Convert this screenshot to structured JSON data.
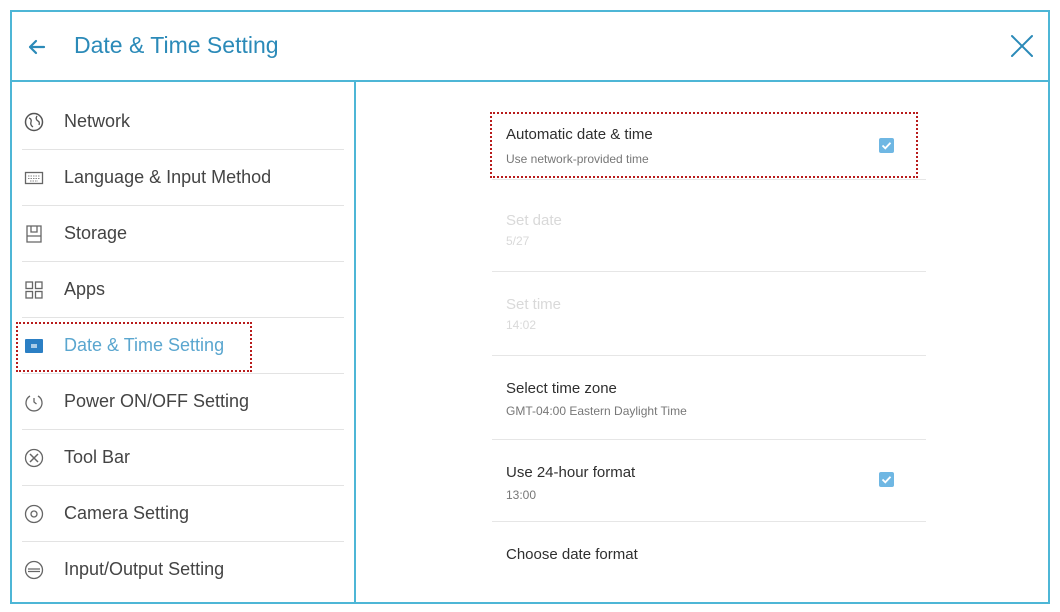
{
  "header": {
    "title": "Date & Time Setting",
    "back_icon": "arrow-left-icon",
    "close_icon": "close-icon"
  },
  "sidebar": {
    "items": [
      {
        "label": "Network",
        "icon": "globe-icon"
      },
      {
        "label": "Language & Input Method",
        "icon": "keyboard-icon"
      },
      {
        "label": "Storage",
        "icon": "storage-icon"
      },
      {
        "label": "Apps",
        "icon": "apps-grid-icon"
      },
      {
        "label": "Date & Time Setting",
        "icon": "calendar-icon",
        "active": true
      },
      {
        "label": "Power ON/OFF Setting",
        "icon": "power-clock-icon"
      },
      {
        "label": "Tool Bar",
        "icon": "toolbar-icon"
      },
      {
        "label": "Camera Setting",
        "icon": "camera-icon"
      },
      {
        "label": "Input/Output Setting",
        "icon": "input-output-icon"
      }
    ]
  },
  "settings": {
    "automatic": {
      "title": "Automatic date & time",
      "subtitle": "Use network-provided time",
      "checked": true
    },
    "set_date": {
      "title": "Set date",
      "subtitle": "5/27",
      "enabled": false
    },
    "set_time": {
      "title": "Set time",
      "subtitle": "14:02",
      "enabled": false
    },
    "time_zone": {
      "title": "Select time zone",
      "subtitle": "GMT-04:00 Eastern Daylight Time"
    },
    "hour_format": {
      "title": "Use 24-hour format",
      "subtitle": "13:00",
      "checked": true
    },
    "date_format": {
      "title": "Choose date format"
    }
  },
  "colors": {
    "accent": "#2b8ab8",
    "border": "#4db6d6",
    "highlight_outline": "#b81c1c",
    "checkbox": "#6fb7e3"
  }
}
